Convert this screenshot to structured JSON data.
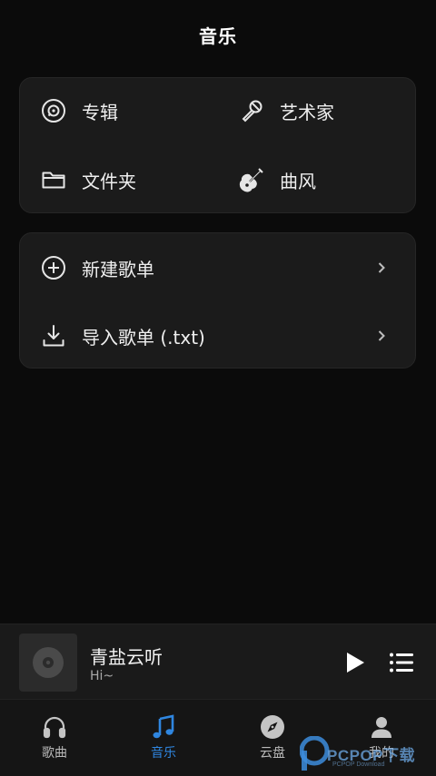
{
  "header": {
    "title": "音乐"
  },
  "categories": [
    {
      "label": "专辑",
      "icon": "album-disc-icon"
    },
    {
      "label": "艺术家",
      "icon": "microphone-icon"
    },
    {
      "label": "文件夹",
      "icon": "folder-icon"
    },
    {
      "label": "曲风",
      "icon": "guitar-icon"
    }
  ],
  "playlist_actions": [
    {
      "label": "新建歌单",
      "icon": "plus-circle-icon"
    },
    {
      "label": "导入歌单 (.txt)",
      "icon": "download-icon"
    }
  ],
  "player": {
    "title": "青盐云听",
    "subtitle": "Hi~"
  },
  "tabs": [
    {
      "label": "歌曲",
      "icon": "headphones-icon",
      "active": false
    },
    {
      "label": "音乐",
      "icon": "music-note-icon",
      "active": true
    },
    {
      "label": "云盘",
      "icon": "compass-icon",
      "active": false
    },
    {
      "label": "我的",
      "icon": "user-icon",
      "active": false
    }
  ],
  "watermark": {
    "text": "PCPOP下载",
    "sub": "PCPOP Download"
  },
  "colors": {
    "background": "#0b0b0b",
    "card": "#1b1b1b",
    "accent": "#2f86e0",
    "text": "#efefef"
  }
}
